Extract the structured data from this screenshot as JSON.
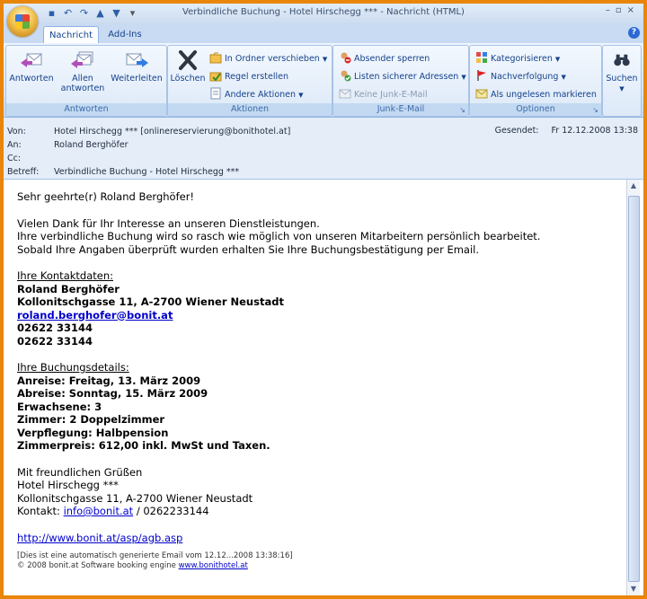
{
  "window": {
    "title": "Verbindliche Buchung - Hotel Hirschegg *** - Nachricht (HTML)"
  },
  "tabs": [
    {
      "label": "Nachricht",
      "active": true
    },
    {
      "label": "Add-Ins",
      "active": false
    }
  ],
  "ribbon": {
    "groups": {
      "antworten": {
        "label": "Antworten",
        "buttons": {
          "reply": "Antworten",
          "reply_all_1": "Allen",
          "reply_all_2": "antworten",
          "forward": "Weiterleiten"
        }
      },
      "aktionen": {
        "label": "Aktionen",
        "delete": "Löschen",
        "move_to_folder": "In Ordner verschieben",
        "create_rule": "Regel erstellen",
        "other_actions": "Andere Aktionen"
      },
      "junk": {
        "label": "Junk-E-Mail",
        "block_sender": "Absender sperren",
        "safe_senders": "Listen sicherer Adressen",
        "not_junk": "Keine Junk-E-Mail"
      },
      "optionen": {
        "label": "Optionen",
        "categorize": "Kategorisieren",
        "follow_up": "Nachverfolgung",
        "mark_unread": "Als ungelesen markieren"
      },
      "suchen": {
        "label": "Suchen"
      }
    }
  },
  "header": {
    "from_label": "Von:",
    "from_value": "Hotel Hirschegg *** [onlinereservierung@bonithotel.at]",
    "to_label": "An:",
    "to_value": "Roland Berghöfer",
    "cc_label": "Cc:",
    "cc_value": "",
    "subject_label": "Betreff:",
    "subject_value": "Verbindliche Buchung - Hotel Hirschegg ***",
    "sent_label": "Gesendet:",
    "sent_value": "Fr 12.12.2008 13:38"
  },
  "body": {
    "greeting": "Sehr geehrte(r) Roland Berghöfer!",
    "intro_1": "Vielen Dank für Ihr Interesse an unseren Dienstleistungen.",
    "intro_2": "Ihre verbindliche Buchung wird so rasch wie möglich von unseren Mitarbeitern persönlich bearbeitet.",
    "intro_3": "Sobald Ihre Angaben überprüft wurden erhalten Sie Ihre Buchungsbestätigung per Email.",
    "contact_heading": "Ihre Kontaktdaten:",
    "contact_name": "Roland Berghöfer",
    "contact_address": "Kollonitschgasse 11, A-2700 Wiener Neustadt",
    "contact_email": "roland.berghofer@bonit.at",
    "contact_phone_1": "02622 33144",
    "contact_phone_2": "02622 33144",
    "booking_heading": "Ihre Buchungsdetails:",
    "arrival": "Anreise: Freitag, 13. März 2009",
    "departure": "Abreise: Sonntag, 15. März 2009",
    "adults": "Erwachsene: 3",
    "rooms": "Zimmer: 2 Doppelzimmer",
    "board": "Verpflegung: Halbpension",
    "price": "Zimmerpreis: 612,00 inkl. MwSt und Taxen.",
    "closing": "Mit freundlichen Grüßen",
    "sig_name": "Hotel Hirschegg ***",
    "sig_address": "Kollonitschgasse 11, A-2700 Wiener Neustadt",
    "sig_contact_prefix": "Kontakt: ",
    "sig_contact_email": "info@bonit.at",
    "sig_contact_suffix": " / 0262233144",
    "agb_link": "http://www.bonit.at/asp/agb.asp",
    "footer_1": "[Dies ist eine automatisch generierte Email vom 12.12...2008 13:38:16]",
    "footer_2_prefix": "© 2008 bonit.at Software booking engine ",
    "footer_2_link": "www.bonithotel.at"
  }
}
